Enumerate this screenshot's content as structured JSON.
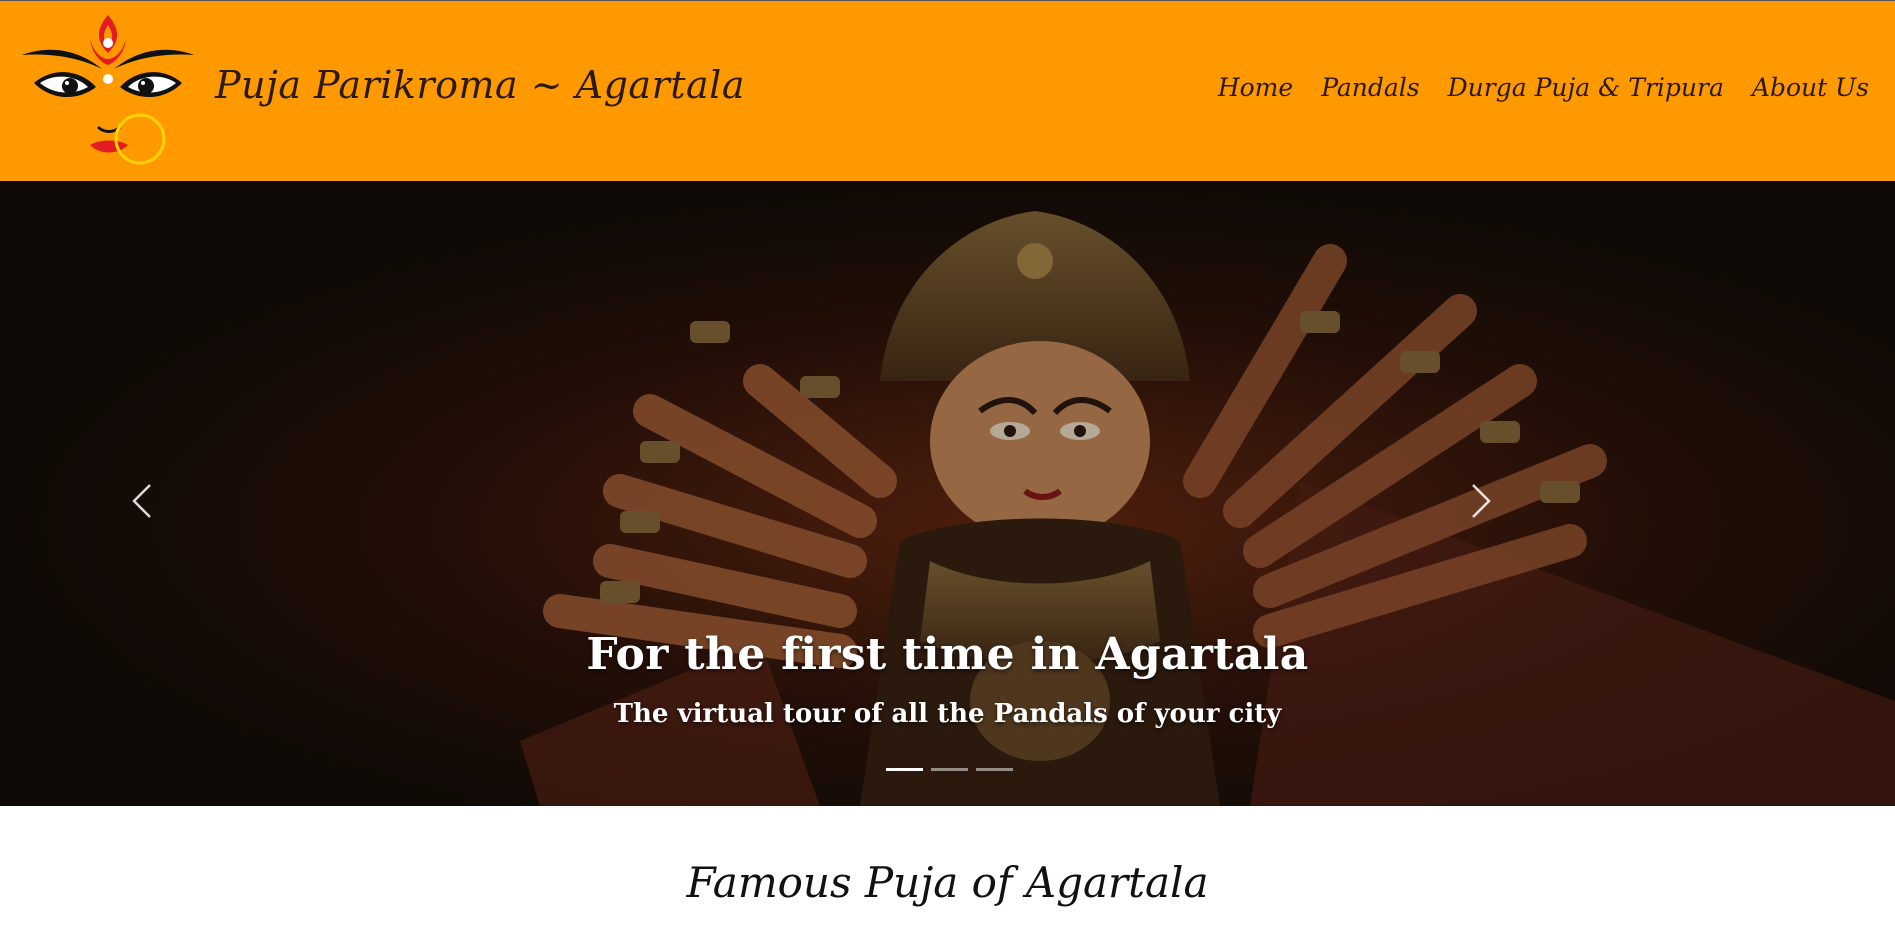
{
  "header": {
    "brand": "Puja Parikroma ~ Agartala",
    "logo_icon": "durga-face-logo",
    "background": "#ff9900"
  },
  "nav": {
    "items": [
      {
        "label": "Home"
      },
      {
        "label": "Pandals"
      },
      {
        "label": "Durga Puja & Tripura"
      },
      {
        "label": "About Us"
      }
    ]
  },
  "carousel": {
    "title": "For the first time in Agartala",
    "subtitle": "The virtual tour of all the Pandals of your city",
    "prev_icon": "chevron-left-icon",
    "next_icon": "chevron-right-icon",
    "slides_count": 3,
    "active_slide": 1
  },
  "section": {
    "title": "Famous Puja of Agartala"
  }
}
